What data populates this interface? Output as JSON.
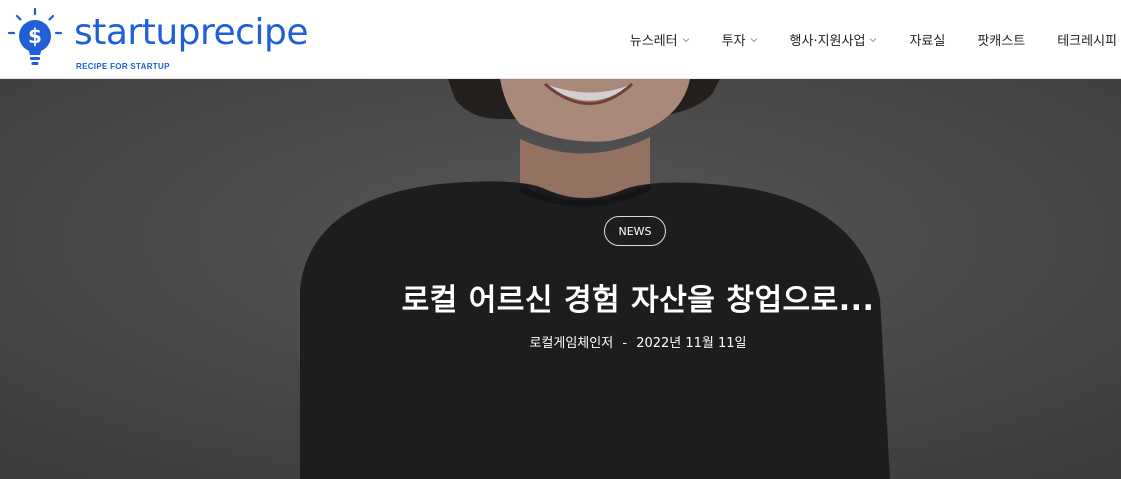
{
  "brand": {
    "name": "startuprecipe",
    "tagline": "RECIPE FOR STARTUP",
    "color": "#1f5fd8"
  },
  "nav": {
    "items": [
      {
        "label": "뉴스레터",
        "has_dropdown": true
      },
      {
        "label": "투자",
        "has_dropdown": true
      },
      {
        "label": "행사·지원사업",
        "has_dropdown": true
      },
      {
        "label": "자료실",
        "has_dropdown": false
      },
      {
        "label": "팟캐스트",
        "has_dropdown": false
      },
      {
        "label": "테크레시피",
        "has_dropdown": false
      }
    ]
  },
  "article": {
    "category": "NEWS",
    "title": "로컬 어르신 경험 자산을 창업으로...",
    "author": "로컬게임체인저",
    "separator": "-",
    "date": "2022년 11월 11일"
  }
}
